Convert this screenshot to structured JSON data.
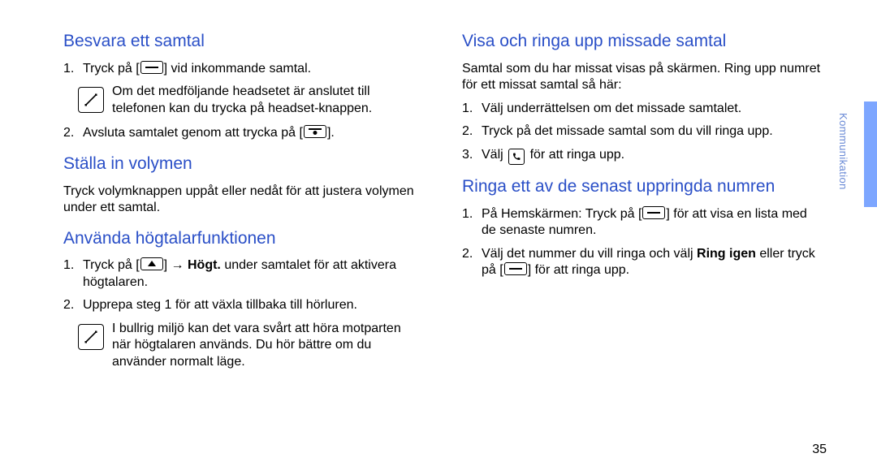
{
  "page_number": "35",
  "side_label": "Kommunikation",
  "left": {
    "h1": "Besvara ett samtal",
    "s1_li1_pre": "Tryck på ",
    "s1_li1_post": " vid inkommande samtal.",
    "s1_note": "Om det medföljande headsetet är anslutet till telefonen kan du trycka på headset-knappen.",
    "s1_li2_pre": "Avsluta samtalet genom att trycka på ",
    "s1_li2_post": ".",
    "h2": "Ställa in volymen",
    "s2_para": "Tryck volymknappen uppåt eller nedåt för att justera volymen under ett samtal.",
    "h3": "Använda högtalarfunktionen",
    "s3_li1_pre": "Tryck på ",
    "s3_li1_arrow": " → ",
    "s3_li1_bold": "Högt.",
    "s3_li1_post": " under samtalet för att aktivera högtalaren.",
    "s3_li2": "Upprepa steg 1 för att växla tillbaka till hörluren.",
    "s3_note": "I bullrig miljö kan det vara svårt att höra motparten när högtalaren används. Du hör bättre om du använder normalt läge."
  },
  "right": {
    "h1": "Visa och ringa upp missade samtal",
    "s1_para": "Samtal som du har missat visas på skärmen. Ring upp numret för ett missat samtal så här:",
    "s1_li1": "Välj underrättelsen om det missade samtalet.",
    "s1_li2": "Tryck på det missade samtal som du vill ringa upp.",
    "s1_li3_pre": "Välj ",
    "s1_li3_post": " för att ringa upp.",
    "h2": "Ringa ett av de senast uppringda numren",
    "s2_li1_pre": "På Hemskärmen: Tryck på ",
    "s2_li1_post": " för att visa en lista med de senaste numren.",
    "s2_li2_pre": "Välj det nummer du vill ringa och välj ",
    "s2_li2_bold": "Ring igen",
    "s2_li2_mid": " eller tryck på ",
    "s2_li2_post": " för att ringa upp."
  }
}
